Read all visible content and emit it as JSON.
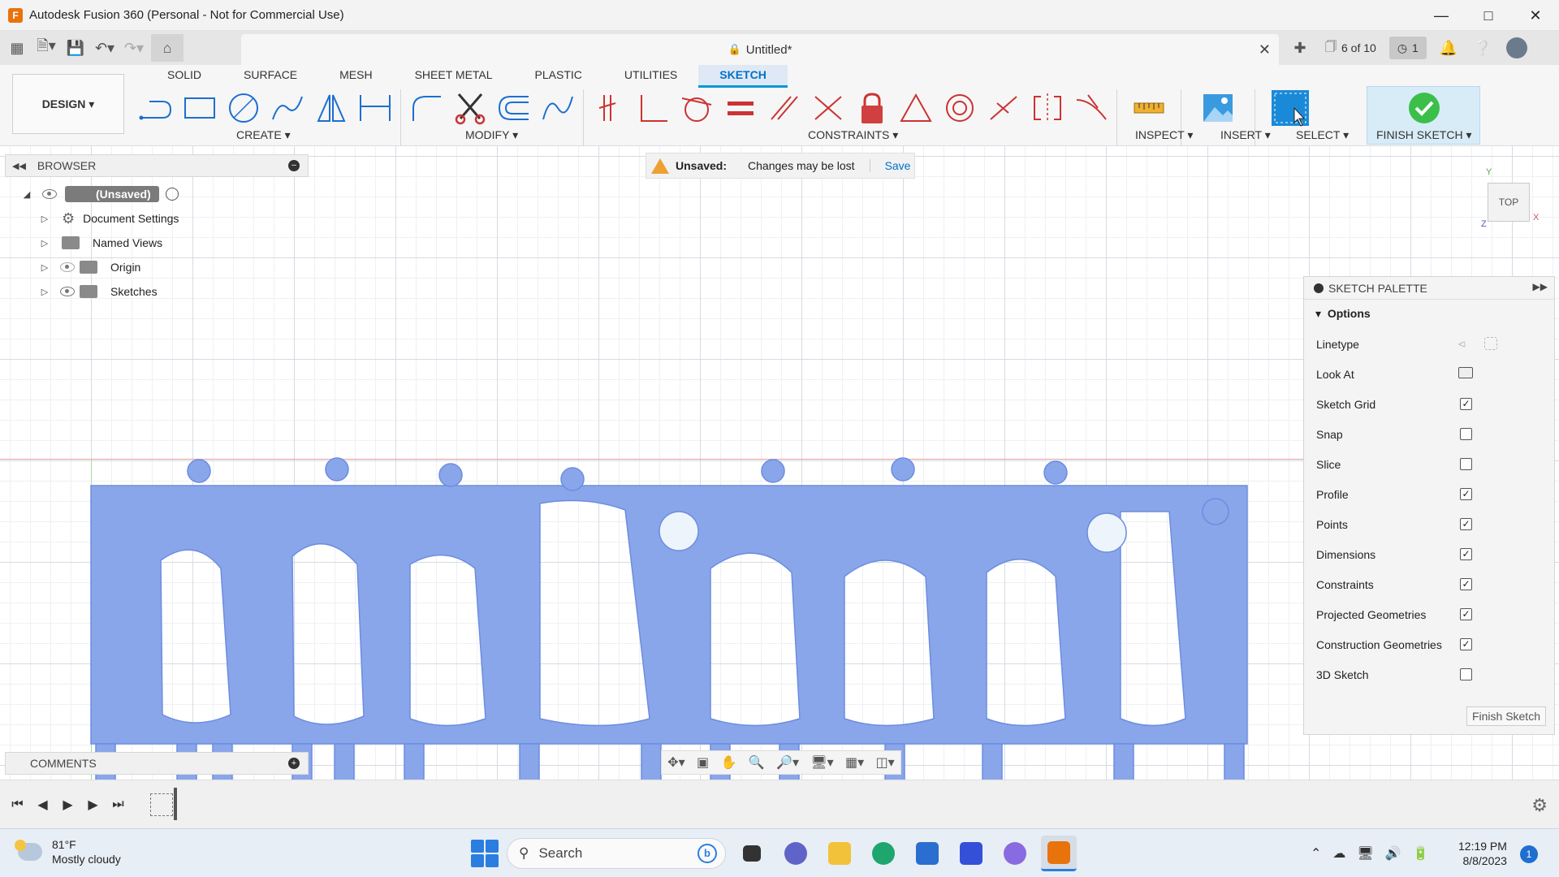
{
  "window": {
    "title": "Autodesk Fusion 360 (Personal - Not for Commercial Use)",
    "logo_letter": "F"
  },
  "document": {
    "tab_title": "Untitled*",
    "version": "6 of 10",
    "jobs_count": "1"
  },
  "ribbon": {
    "workspace": "DESIGN",
    "tabs": [
      "SOLID",
      "SURFACE",
      "MESH",
      "SHEET METAL",
      "PLASTIC",
      "UTILITIES",
      "SKETCH"
    ],
    "active_tab": "SKETCH",
    "groups": {
      "create": "CREATE",
      "modify": "MODIFY",
      "constraints": "CONSTRAINTS",
      "inspect": "INSPECT",
      "insert": "INSERT",
      "select": "SELECT",
      "finish": "FINISH SKETCH"
    }
  },
  "browser": {
    "title": "BROWSER",
    "root": "(Unsaved)",
    "items": [
      "Document Settings",
      "Named Views",
      "Origin",
      "Sketches"
    ]
  },
  "banner": {
    "label": "Unsaved:",
    "message": "Changes may be lost",
    "action": "Save"
  },
  "viewcube": {
    "face": "TOP",
    "axis_y": "Y",
    "axis_x": "X",
    "axis_z": "Z"
  },
  "palette": {
    "title": "SKETCH PALETTE",
    "section": "Options",
    "rows": [
      {
        "label": "Linetype",
        "type": "icons"
      },
      {
        "label": "Look At",
        "type": "icon"
      },
      {
        "label": "Sketch Grid",
        "checked": true
      },
      {
        "label": "Snap",
        "checked": false
      },
      {
        "label": "Slice",
        "checked": false
      },
      {
        "label": "Profile",
        "checked": true
      },
      {
        "label": "Points",
        "checked": true
      },
      {
        "label": "Dimensions",
        "checked": true
      },
      {
        "label": "Constraints",
        "checked": true
      },
      {
        "label": "Projected Geometries",
        "checked": true
      },
      {
        "label": "Construction Geometries",
        "checked": true
      },
      {
        "label": "3D Sketch",
        "checked": false
      }
    ],
    "finish_button": "Finish Sketch"
  },
  "comments": {
    "title": "COMMENTS"
  },
  "taskbar": {
    "temperature": "81°F",
    "weather": "Mostly cloudy",
    "search_placeholder": "Search",
    "time": "12:19 PM",
    "date": "8/8/2023",
    "notifications": "1"
  },
  "colors": {
    "sketch_fill": "#8aa6ea",
    "sketch_hole": "#eef4fb",
    "accent": "#0696d7",
    "finish_check": "#3cbf4a"
  }
}
